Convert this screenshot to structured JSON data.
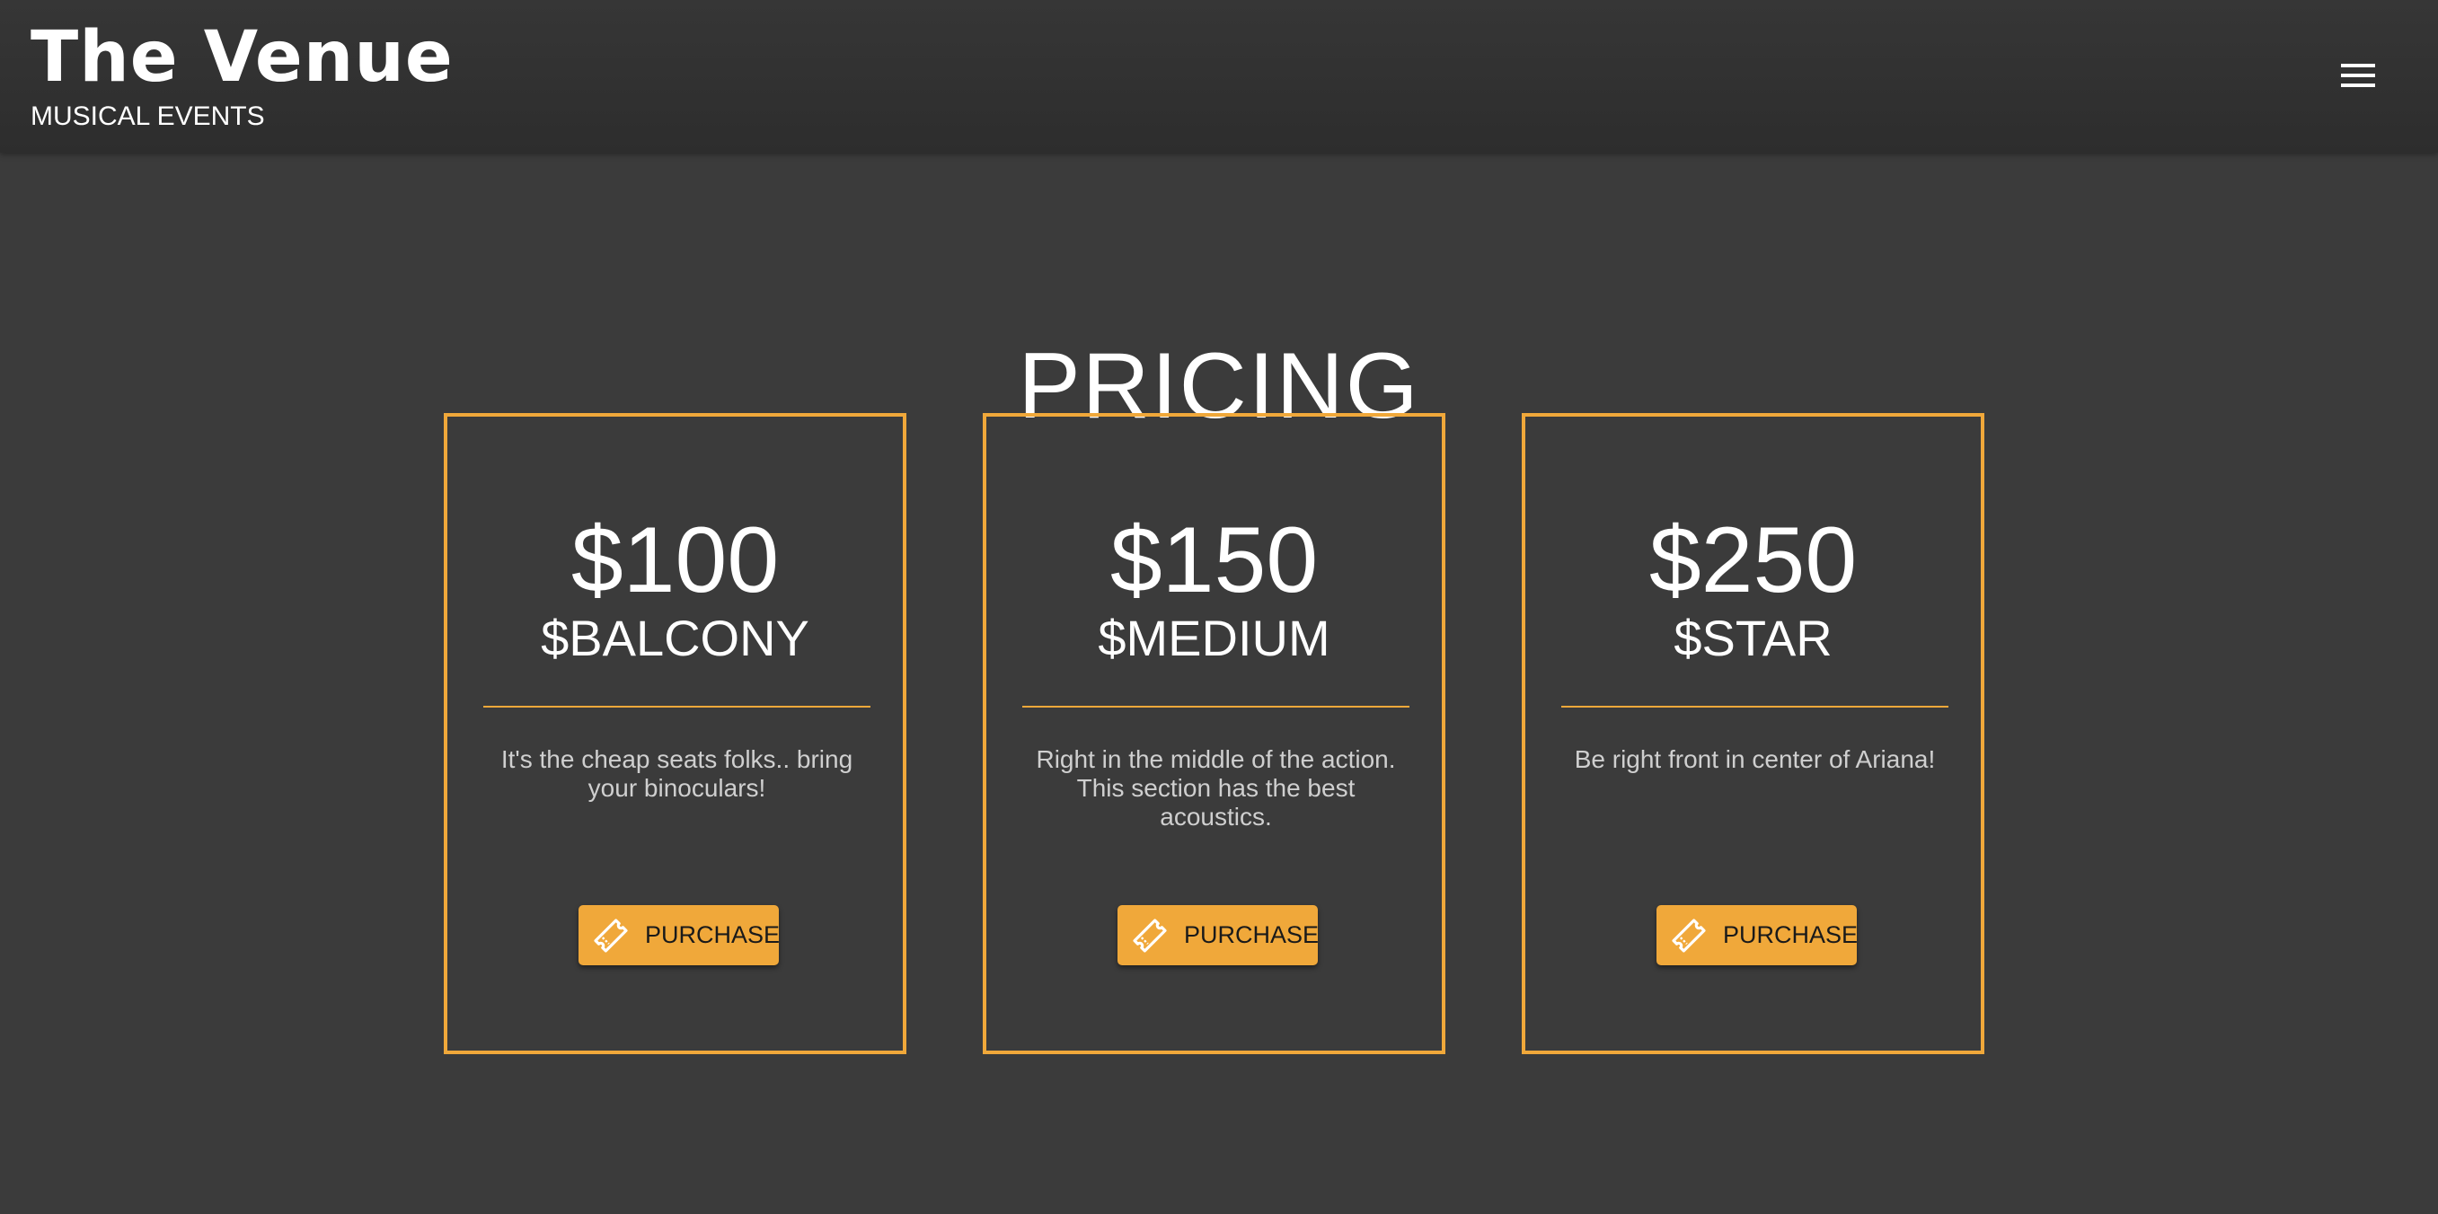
{
  "header": {
    "title": "The Venue",
    "subtitle": "MUSICAL EVENTS",
    "menu_icon": "hamburger-menu-icon"
  },
  "pricing": {
    "title": "PRICING",
    "accent_color": "#f0a83a",
    "cards": [
      {
        "price": "$100",
        "tier": "$BALCONY",
        "description": "It's the cheap seats folks.. bring your binoculars!",
        "button_label": "PURCHASE",
        "button_icon": "ticket-icon"
      },
      {
        "price": "$150",
        "tier": "$MEDIUM",
        "description": "Right in the middle of the action. This section has the best acoustics.",
        "button_label": "PURCHASE",
        "button_icon": "ticket-icon"
      },
      {
        "price": "$250",
        "tier": "$STAR",
        "description": "Be right front in center of Ariana!",
        "button_label": "PURCHASE",
        "button_icon": "ticket-icon"
      }
    ]
  }
}
